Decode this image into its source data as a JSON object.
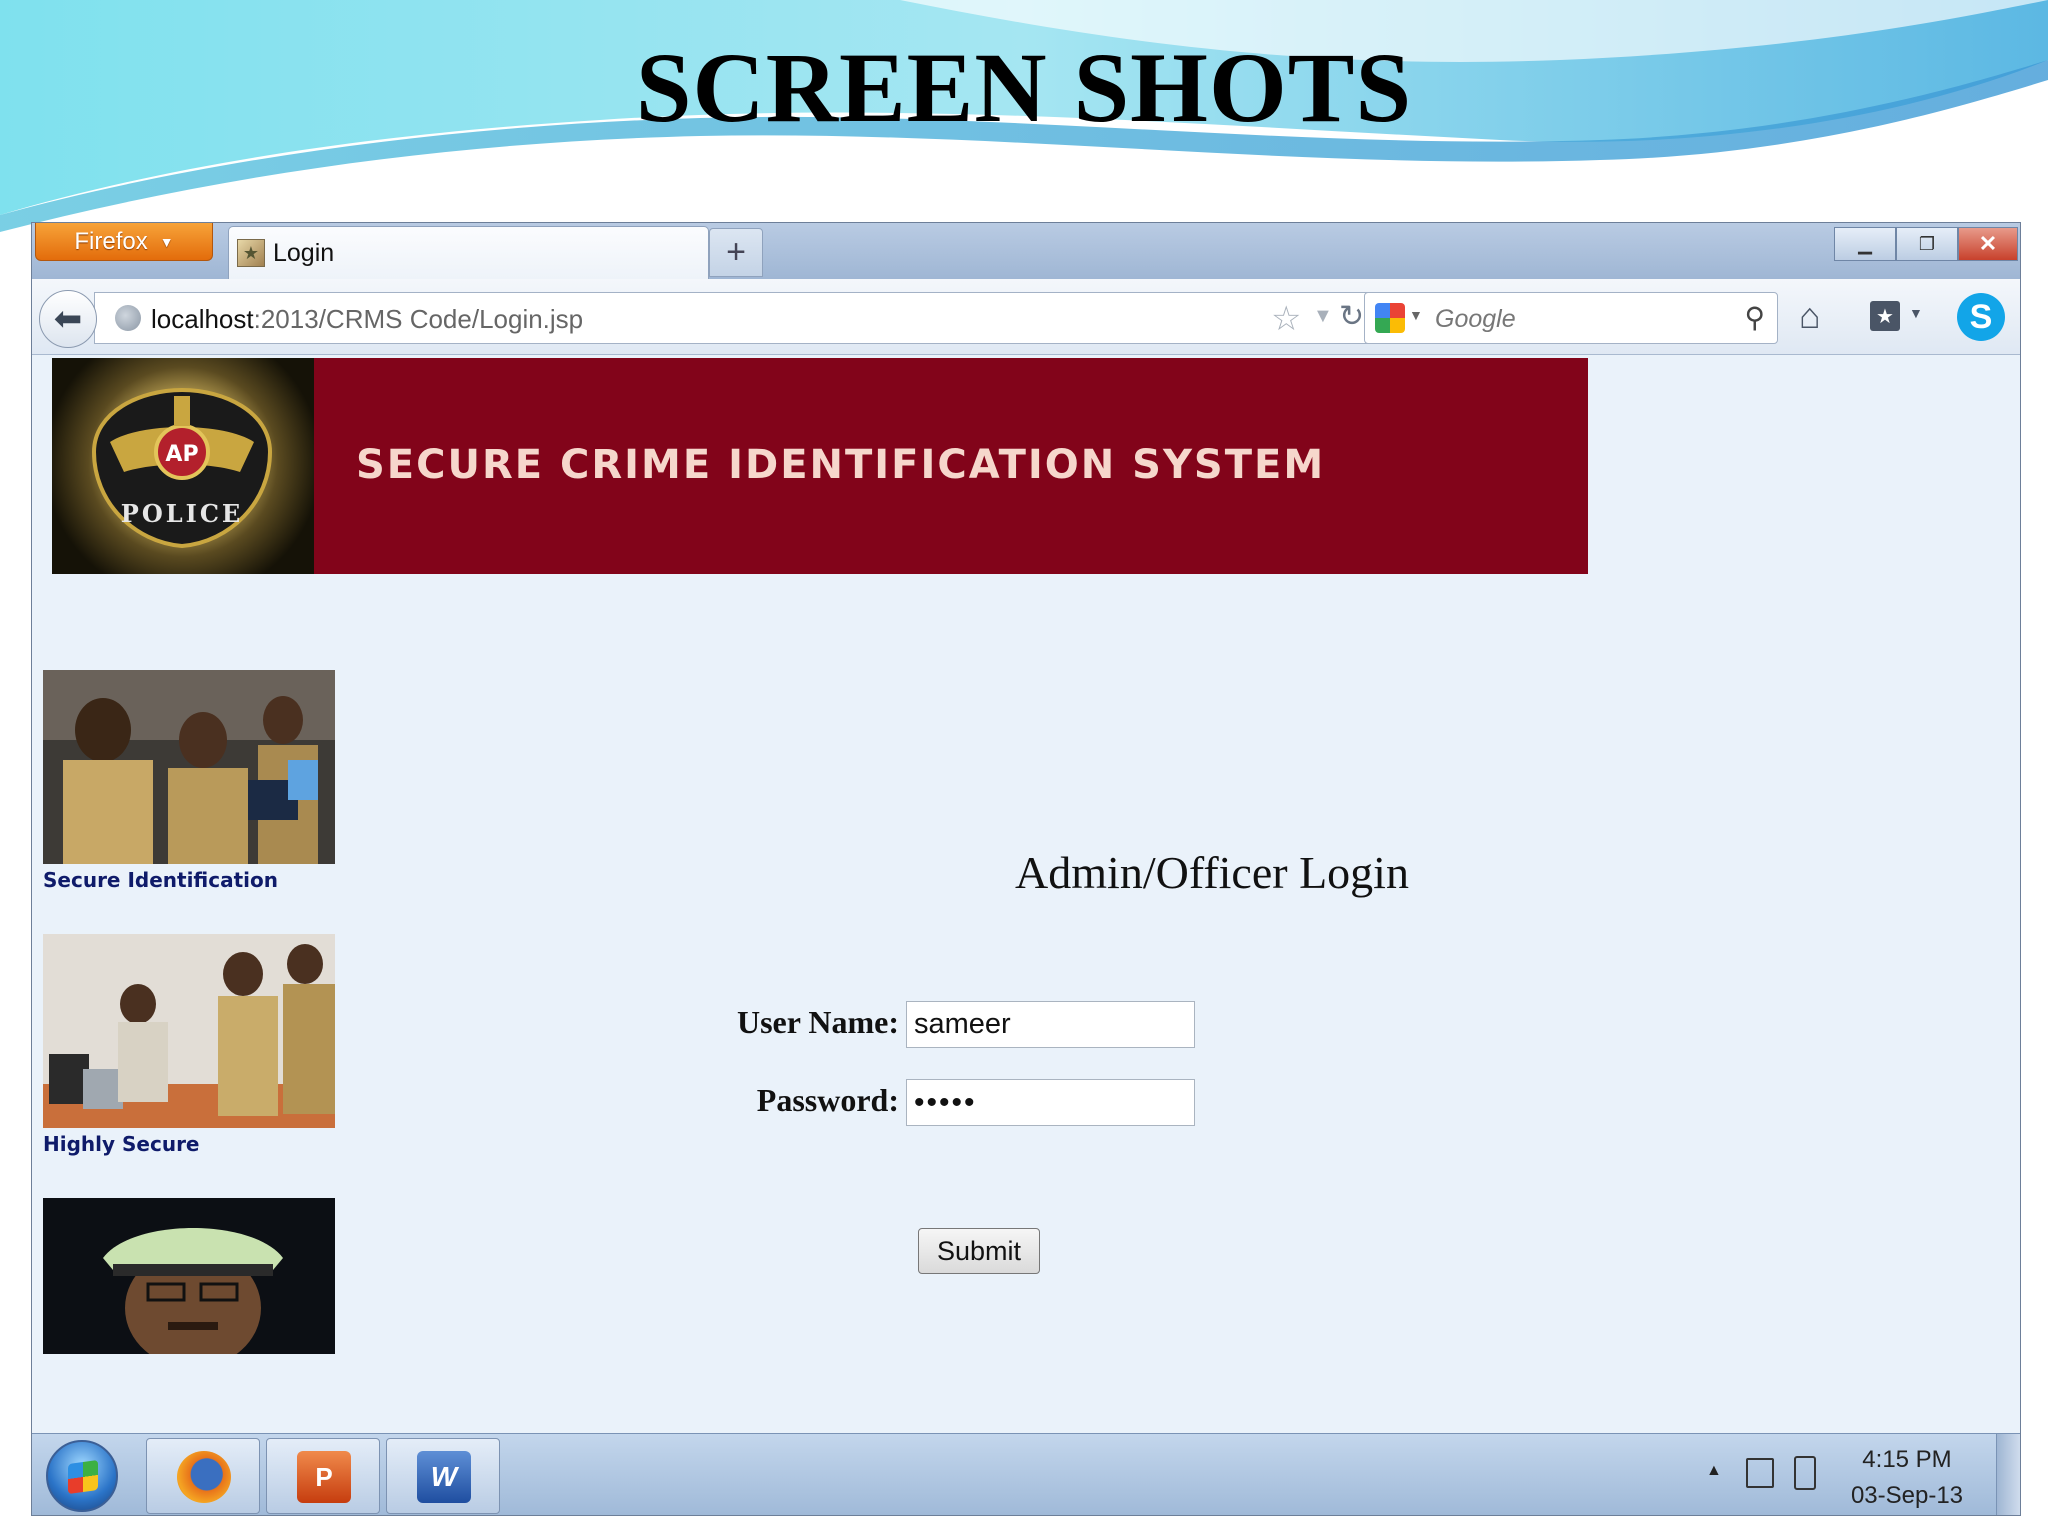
{
  "slide": {
    "title": "SCREEN SHOTS"
  },
  "browser": {
    "menu_button": "Firefox",
    "tab_title": "Login",
    "new_tab": "+",
    "url_host": "localhost",
    "url_rest": ":2013/CRMS Code/Login.jsp",
    "search_placeholder": "Google"
  },
  "page": {
    "banner_title": "SECURE CRIME IDENTIFICATION SYSTEM",
    "badge_text": "AP",
    "badge_lower": "POLICE",
    "side_captions": [
      "Secure Identification",
      "Highly Secure"
    ],
    "login_heading": "Admin/Officer Login",
    "username_label": "User Name:",
    "username_value": "sameer",
    "password_label": "Password:",
    "password_value": "•••••",
    "submit_label": "Submit"
  },
  "taskbar": {
    "time": "4:15 PM",
    "date": "03-Sep-13"
  },
  "colors": {
    "banner": "#82041a",
    "banner_text": "#f6d7cc",
    "firefox_orange": "#e36c0b",
    "page_bg": "#eaf2fa"
  }
}
